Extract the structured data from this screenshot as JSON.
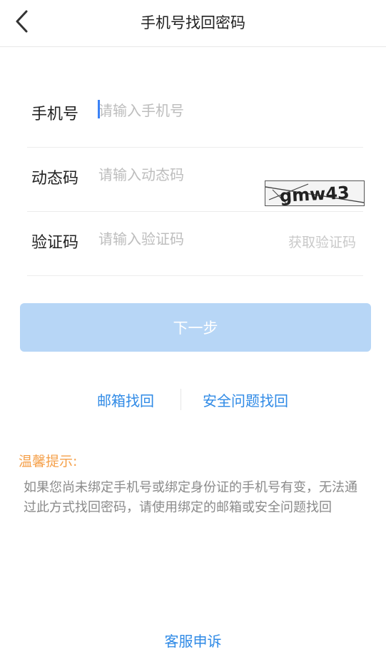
{
  "header": {
    "title": "手机号找回密码",
    "back_icon": "chevron-left-icon"
  },
  "form": {
    "phone": {
      "label": "手机号",
      "placeholder": "请输入手机号"
    },
    "dynamic_code": {
      "label": "动态码",
      "placeholder": "请输入动态码",
      "captcha_text": "gmw43"
    },
    "verify_code": {
      "label": "验证码",
      "placeholder": "请输入验证码",
      "get_code_label": "获取验证码"
    }
  },
  "next_button": {
    "label": "下一步",
    "color": "#b7d6f6"
  },
  "alt_recovery": {
    "email_label": "邮箱找回",
    "security_label": "安全问题找回",
    "link_color": "#2f8ae6"
  },
  "tip": {
    "title": "温馨提示:",
    "text": "如果您尚未绑定手机号或绑定身份证的手机号有变，无法通过此方式找回密码，请使用绑定的邮箱或安全问题找回",
    "title_color": "#f5a04a"
  },
  "footer": {
    "service_label": "客服申诉"
  }
}
